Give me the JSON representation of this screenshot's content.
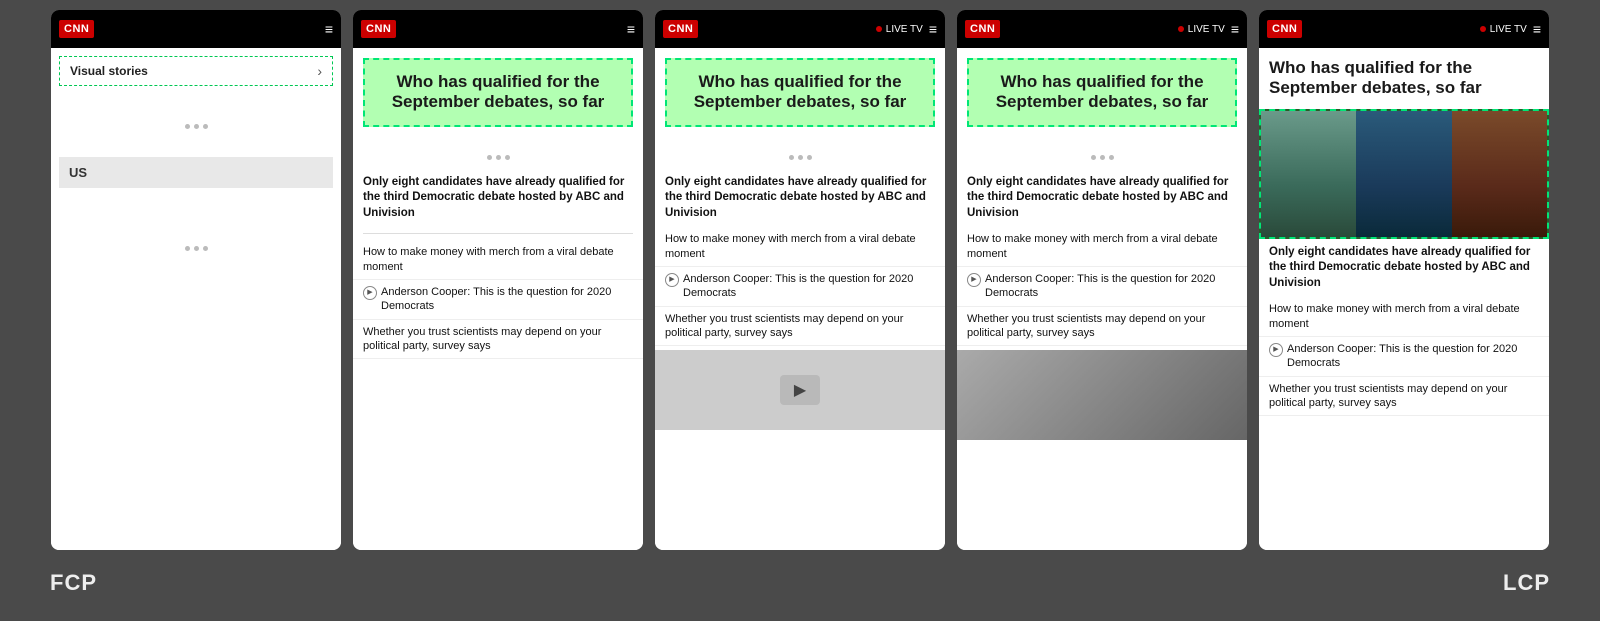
{
  "background_color": "#4a4a4a",
  "frames": [
    {
      "id": "frame1",
      "type": "visual_stories",
      "header": {
        "logo": "CNN",
        "show_live_tv": false
      },
      "content": {
        "visual_stories_label": "Visual stories",
        "section_label": "US"
      }
    },
    {
      "id": "frame2",
      "type": "article",
      "header": {
        "logo": "CNN",
        "show_live_tv": false
      },
      "content": {
        "title": "Who has qualified for the September debates, so far",
        "snippet": "Only eight candidates have already qualified for the third Democratic debate hosted by ABC and Univision",
        "sub_articles": [
          {
            "text": "How to make money with merch from a viral debate moment",
            "has_icon": false
          },
          {
            "text": "Anderson Cooper: This is the question for 2020 Democrats",
            "has_icon": true
          },
          {
            "text": "Whether you trust scientists may depend on your political party, survey says",
            "has_icon": false
          }
        ]
      }
    },
    {
      "id": "frame3",
      "type": "article",
      "header": {
        "logo": "CNN",
        "show_live_tv": true,
        "live_tv_label": "LIVE TV"
      },
      "content": {
        "title": "Who has qualified for the September debates, so far",
        "snippet": "Only eight candidates have already qualified for the third Democratic debate hosted by ABC and Univision",
        "sub_articles": [
          {
            "text": "How to make money with merch from a viral debate moment",
            "has_icon": false
          },
          {
            "text": "Anderson Cooper: This is the question for 2020 Democrats",
            "has_icon": true
          },
          {
            "text": "Whether you trust scientists may depend on your political party, survey says",
            "has_icon": false
          }
        ],
        "has_video_overlay": true
      }
    },
    {
      "id": "frame4",
      "type": "article",
      "header": {
        "logo": "CNN",
        "show_live_tv": true,
        "live_tv_label": "LIVE TV"
      },
      "content": {
        "title": "Who has qualified for the September debates, so far",
        "snippet": "Only eight candidates have already qualified for the third Democratic debate hosted by ABC and Univision",
        "sub_articles": [
          {
            "text": "How to make money with merch from a viral debate moment",
            "has_icon": false
          },
          {
            "text": "Anderson Cooper: This is the question for 2020 Democrats",
            "has_icon": true
          },
          {
            "text": "Whether you trust scientists may depend on your political party, survey says",
            "has_icon": false
          }
        ],
        "has_image": true
      }
    },
    {
      "id": "frame5",
      "type": "article_lcp",
      "header": {
        "logo": "CNN",
        "show_live_tv": true,
        "live_tv_label": "LIVE TV"
      },
      "content": {
        "title": "Who has qualified for the September debates, so far",
        "snippet": "Only eight candidates have already qualified for the third Democratic debate hosted by ABC and Univision",
        "sub_articles": [
          {
            "text": "How to make money with merch from a viral debate moment",
            "has_icon": false
          },
          {
            "text": "Anderson Cooper: This is the question for 2020 Democrats",
            "has_icon": true
          },
          {
            "text": "Whether you trust scientists may depend on your political party, survey says",
            "has_icon": false
          }
        ],
        "has_candidates_image": true
      }
    }
  ],
  "bottom_labels": {
    "fcp": "FCP",
    "lcp": "LCP"
  },
  "icons": {
    "hamburger": "≡",
    "chevron_right": "›",
    "play": "▶",
    "dot": "•"
  }
}
